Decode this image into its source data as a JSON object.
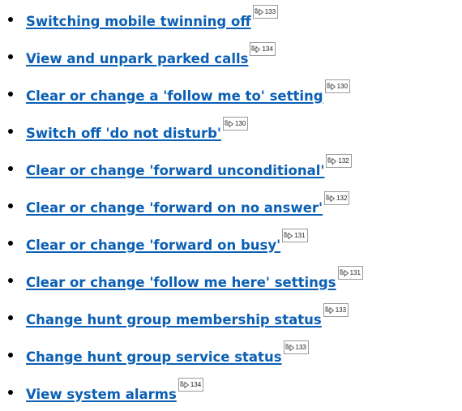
{
  "links": [
    {
      "label": "Switching mobile twinning off",
      "page": "133",
      "icon": "page-ref-arrow-icon"
    },
    {
      "label": "View and unpark parked calls",
      "page": "134",
      "icon": "page-ref-arrow-icon"
    },
    {
      "label": "Clear or change a 'follow me to' setting",
      "page": "130",
      "icon": "page-ref-arrow-icon"
    },
    {
      "label": "Switch off 'do not disturb'",
      "page": "130",
      "icon": "page-ref-arrow-icon"
    },
    {
      "label": "Clear or change 'forward unconditional'",
      "page": "132",
      "icon": "page-ref-arrow-icon"
    },
    {
      "label": "Clear or change 'forward on no answer'",
      "page": "132",
      "icon": "page-ref-arrow-icon"
    },
    {
      "label": "Clear or change 'forward on busy'",
      "page": "131",
      "icon": "page-ref-arrow-icon"
    },
    {
      "label": "Clear or change 'follow me here' settings",
      "page": "131",
      "icon": "page-ref-arrow-icon"
    },
    {
      "label": "Change hunt group membership status",
      "page": "133",
      "icon": "page-ref-arrow-icon"
    },
    {
      "label": "Change hunt group service status",
      "page": "133",
      "icon": "page-ref-arrow-icon"
    },
    {
      "label": "View system alarms",
      "page": "134",
      "icon": "page-ref-arrow-icon"
    }
  ],
  "colors": {
    "link": "#0b5fb4",
    "bullet": "#000000",
    "ref_border": "#9a9a9a"
  }
}
